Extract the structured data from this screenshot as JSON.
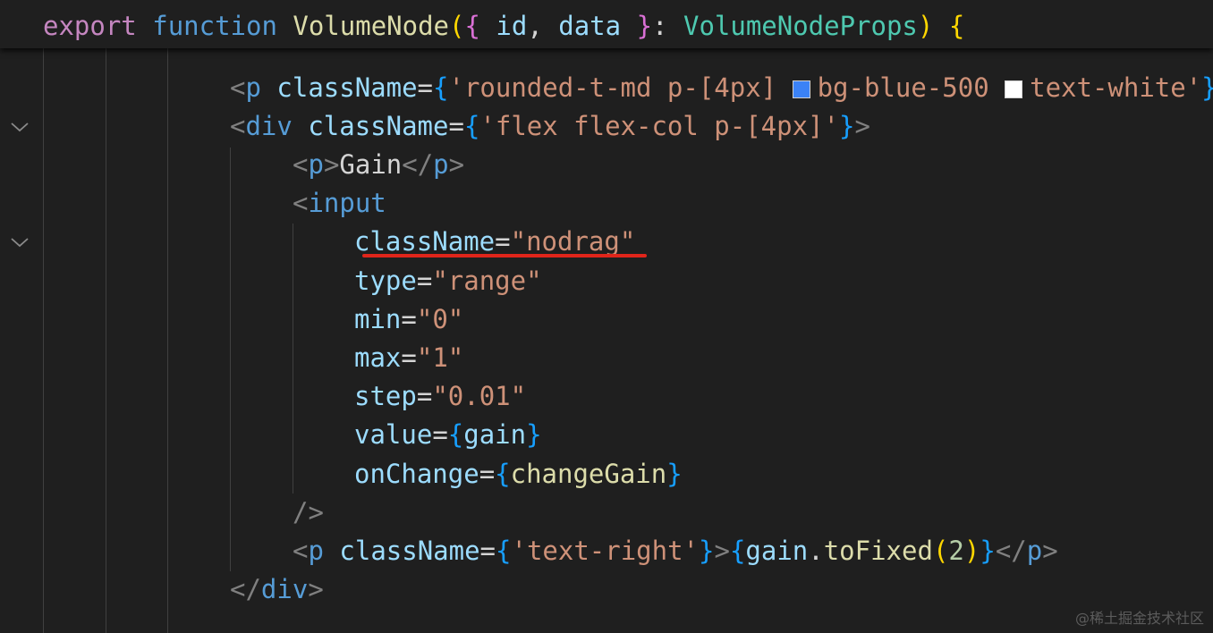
{
  "editor": {
    "sticky_header": {
      "kw_export": "export",
      "kw_function": "function",
      "fn_name": "VolumeNode",
      "paren_open": "(",
      "brace_open": "{",
      "param_id": "id",
      "comma": ",",
      "param_data": "data",
      "brace_close": "}",
      "colon": ":",
      "type_name": "VolumeNodeProps",
      "paren_close": ")",
      "body_brace": "{"
    },
    "lines": {
      "l1": {
        "lt": "<",
        "tag": "p",
        "attr": "className",
        "eq": "=",
        "brace": "{",
        "str_a": "'rounded-t-md p-[4px] ",
        "str_b": "bg-blue-500 ",
        "str_c": "text-white'",
        "brace_close": "}",
        "swatch1_color": "#3b82f6",
        "swatch2_color": "#ffffff"
      },
      "l2": {
        "lt": "<",
        "tag": "div",
        "attr": "className",
        "eq": "=",
        "brace": "{",
        "str": "'flex flex-col p-[4px]'",
        "brace_close": "}",
        "gt": ">"
      },
      "l3": {
        "open": "<",
        "tag": "p",
        "gt": ">",
        "text": "Gain",
        "close_open": "</",
        "close_tag": "p",
        "close_gt": ">"
      },
      "l4": {
        "lt": "<",
        "tag": "input"
      },
      "l5": {
        "attr": "className",
        "eq": "=",
        "value": "\"nodrag\""
      },
      "l6": {
        "attr": "type",
        "eq": "=",
        "value": "\"range\""
      },
      "l7": {
        "attr": "min",
        "eq": "=",
        "value": "\"0\""
      },
      "l8": {
        "attr": "max",
        "eq": "=",
        "value": "\"1\""
      },
      "l9": {
        "attr": "step",
        "eq": "=",
        "value": "\"0.01\""
      },
      "l10": {
        "attr": "value",
        "eq": "=",
        "brace": "{",
        "expr": "gain",
        "brace_close": "}"
      },
      "l11": {
        "attr": "onChange",
        "eq": "=",
        "brace": "{",
        "expr": "changeGain",
        "brace_close": "}"
      },
      "l12": {
        "text": "/>"
      },
      "l13": {
        "lt": "<",
        "tag": "p",
        "attr": "className",
        "eq": "=",
        "brace": "{",
        "str": "'text-right'",
        "brace_close": "}",
        "gt": ">",
        "brace2": "{",
        "obj": "gain",
        "dot": ".",
        "method": "toFixed",
        "paren_open": "(",
        "num": "2",
        "paren_close": ")",
        "brace2_close": "}",
        "close_open": "</",
        "close_tag": "p",
        "close_gt": ">"
      },
      "l14": {
        "open": "</",
        "tag": "div",
        "gt": ">"
      }
    },
    "fold_icons": [
      "chevron-down",
      "chevron-down"
    ],
    "highlight_color": "#e0251a"
  },
  "watermark": "@稀土掘金技术社区"
}
